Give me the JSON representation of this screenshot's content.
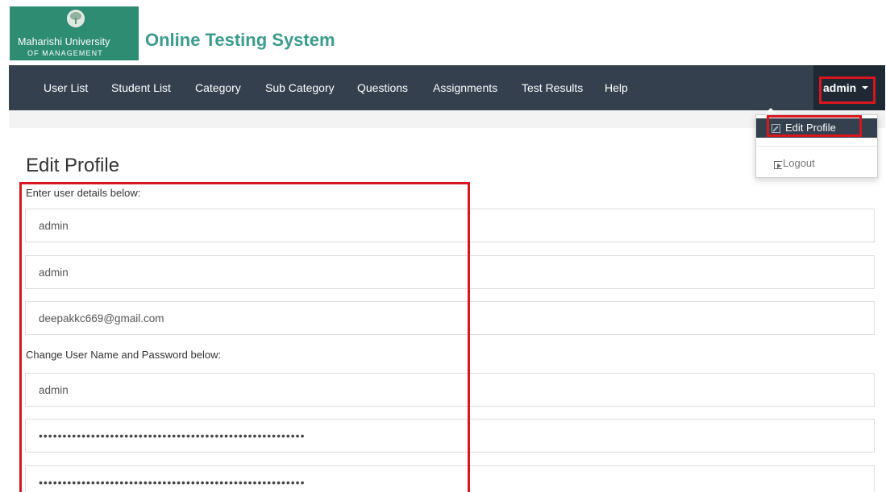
{
  "header": {
    "logo_line1": "Maharishi University",
    "logo_line2": "OF MANAGEMENT",
    "site_title": "Online Testing System"
  },
  "nav": {
    "items": [
      {
        "label": "User List"
      },
      {
        "label": "Student List"
      },
      {
        "label": "Category"
      },
      {
        "label": "Sub Category"
      },
      {
        "label": "Questions"
      },
      {
        "label": "Assignments"
      },
      {
        "label": "Test Results"
      },
      {
        "label": "Help"
      }
    ],
    "user_menu": "admin"
  },
  "dropdown": {
    "edit_profile": "Edit Profile",
    "logout": "Logout"
  },
  "form": {
    "page_title": "Edit Profile",
    "section1_label": "Enter user details below:",
    "first_name": "admin",
    "last_name": "admin",
    "email": "deepakkc669@gmail.com",
    "section2_label": "Change User Name and Password below:",
    "username": "admin",
    "password": "••••••••••••••••••••••••••••••••••••••••••••••••••••••••",
    "confirm_password": "••••••••••••••••••••••••••••••••••••••••••••••••••••••••"
  },
  "colors": {
    "logo_bg": "#2e8c73",
    "title": "#3b9c8e",
    "navbar": "#34404e",
    "highlight": "#d7161e"
  }
}
